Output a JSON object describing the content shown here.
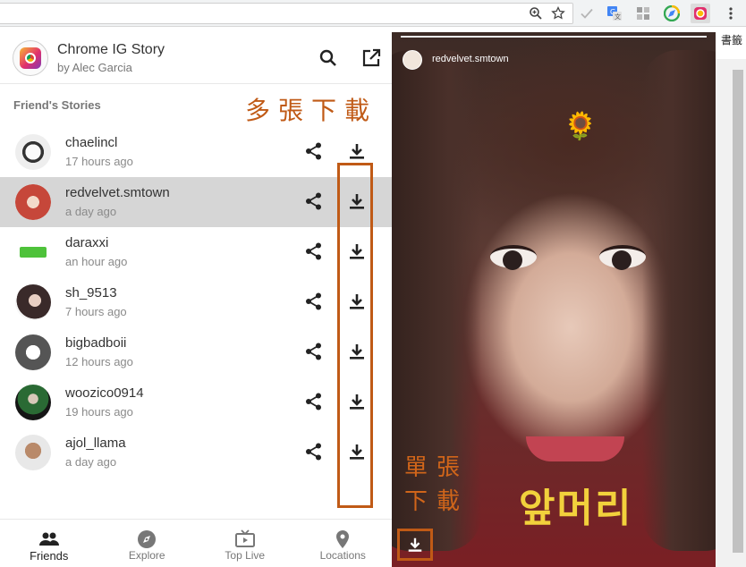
{
  "browser": {
    "toolbar_icons": [
      "zoom-icon",
      "star-icon",
      "checkmark-icon",
      "translate-icon",
      "apps-grid-icon",
      "chrome-ig-story-icon",
      "more-icon"
    ],
    "corner_text": "書籤"
  },
  "header": {
    "title": "Chrome IG Story",
    "author": "by Alec Garcia"
  },
  "section": {
    "title": "Friend's Stories"
  },
  "annotations": {
    "multi_download": "多張下載",
    "single_download": "單張下載"
  },
  "friends": [
    {
      "name": "chaelincl",
      "time": "17 hours ago",
      "selected": false,
      "color": "#2b2b2b"
    },
    {
      "name": "redvelvet.smtown",
      "time": "a day ago",
      "selected": true,
      "color": "#c6473a"
    },
    {
      "name": "daraxxi",
      "time": "an hour ago",
      "selected": false,
      "color": "#4ec23a"
    },
    {
      "name": "sh_9513",
      "time": "7 hours ago",
      "selected": false,
      "color": "#3a2a2a"
    },
    {
      "name": "bigbadboii",
      "time": "12 hours ago",
      "selected": false,
      "color": "#555555"
    },
    {
      "name": "woozico0914",
      "time": "19 hours ago",
      "selected": false,
      "color": "#1f4d2a"
    },
    {
      "name": "ajol_llama",
      "time": "a day ago",
      "selected": false,
      "color": "#b9b9b9"
    }
  ],
  "nav": [
    {
      "label": "Friends",
      "icon": "people-icon",
      "active": true
    },
    {
      "label": "Explore",
      "icon": "compass-icon",
      "active": false
    },
    {
      "label": "Top Live",
      "icon": "tv-icon",
      "active": false
    },
    {
      "label": "Locations",
      "icon": "location-pin-icon",
      "active": false
    }
  ],
  "story": {
    "username": "redvelvet.smtown",
    "caption": "앞머리",
    "sticker": "🌻"
  },
  "colors": {
    "annotation": "#c05a16",
    "caption": "#f2d13c",
    "selected_row": "#d6d6d6"
  }
}
